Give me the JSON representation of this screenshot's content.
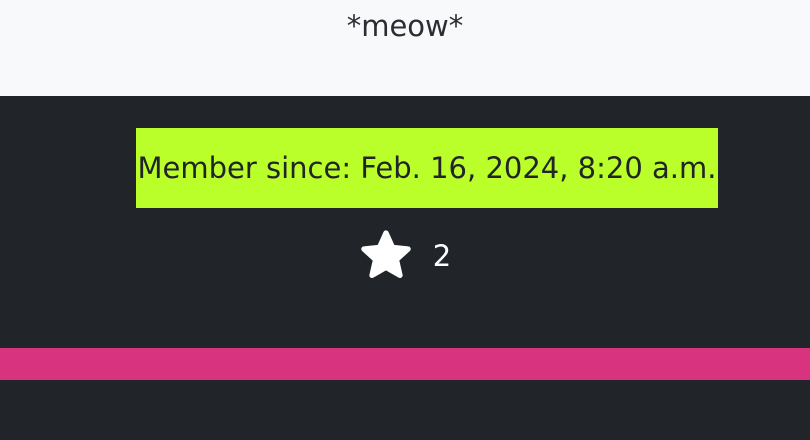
{
  "profile": {
    "bio": "*meow*",
    "member_since": "Member since: Feb. 16, 2024, 8:20 a.m.",
    "star_count": "2",
    "star_icon": "star-icon"
  },
  "colors": {
    "top_panel_bg": "#f8f9fb",
    "page_bg": "#212429",
    "badge_bg": "#baff29",
    "stripe": "#d7337f",
    "star_fill": "#ffffff"
  }
}
